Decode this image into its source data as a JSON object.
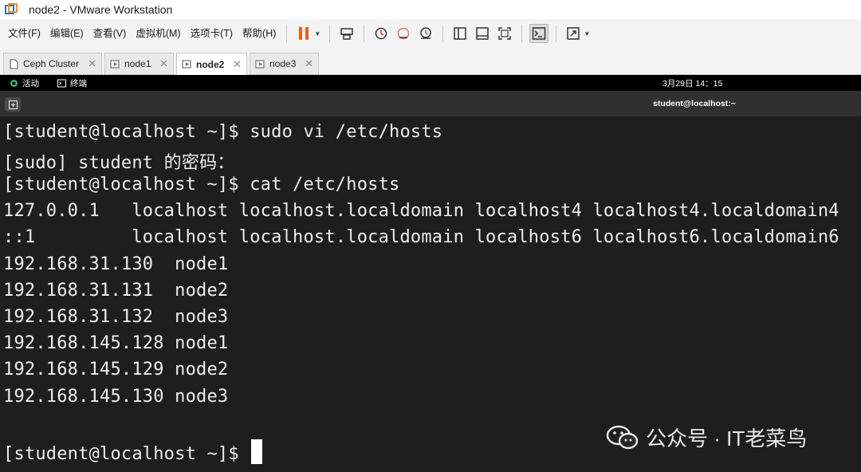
{
  "window": {
    "title": "node2 - VMware Workstation"
  },
  "menu": [
    "文件(F)",
    "编辑(E)",
    "查看(V)",
    "虚拟机(M)",
    "选项卡(T)",
    "帮助(H)"
  ],
  "toolbar_icons": [
    "pause-icon",
    "send-ctrl-alt-del-icon",
    "snapshot-icon",
    "revert-snapshot-icon",
    "snapshot-manager-icon",
    "library-view-icon",
    "thumbnail-view-icon",
    "fullscreen-fit-icon",
    "console-view-icon",
    "unity-icon"
  ],
  "tabs": [
    {
      "label": "Ceph Cluster",
      "active": false
    },
    {
      "label": "node1",
      "active": false
    },
    {
      "label": "node2",
      "active": true
    },
    {
      "label": "node3",
      "active": false
    }
  ],
  "gnome": {
    "activities": "活动",
    "app": "终端",
    "clock": "3月29日  14：15"
  },
  "terminal": {
    "title": "student@localhost:~",
    "lines": [
      "[student@localhost ~]$ sudo vi /etc/hosts",
      "[sudo] student 的密码：",
      "[student@localhost ~]$ cat /etc/hosts",
      "127.0.0.1   localhost localhost.localdomain localhost4 localhost4.localdomain4",
      "::1         localhost localhost.localdomain localhost6 localhost6.localdomain6",
      "192.168.31.130  node1",
      "192.168.31.131  node2",
      "192.168.31.132  node3",
      "192.168.145.128 node1",
      "192.168.145.129 node2",
      "192.168.145.130 node3",
      "",
      "[student@localhost ~]$ "
    ]
  },
  "watermark": "公众号 · IT老菜鸟",
  "colors": {
    "terminal_bg": "#1e1e1e",
    "terminal_fg": "#ededed",
    "pause_orange": "#e8631a"
  }
}
